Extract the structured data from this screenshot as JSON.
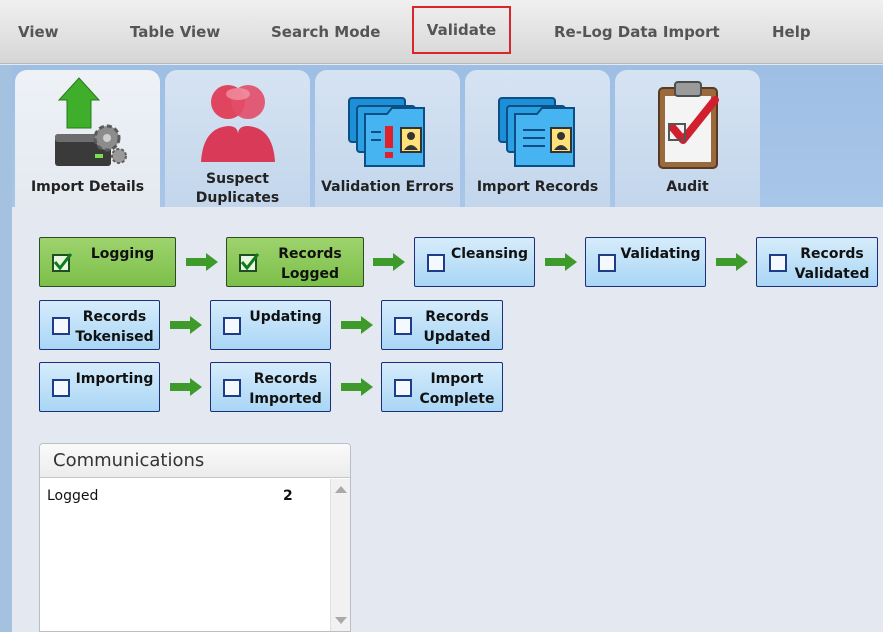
{
  "menu": {
    "view": "View",
    "table_view": "Table View",
    "search_mode": "Search Mode",
    "validate": "Validate",
    "relog": "Re-Log Data Import",
    "help": "Help"
  },
  "tabs": {
    "import_details": "Import Details",
    "suspect_1": "Suspect",
    "suspect_2": "Duplicates",
    "validation_errors": "Validation Errors",
    "import_records": "Import Records",
    "audit": "Audit"
  },
  "steps": {
    "logging": {
      "l1": "Logging",
      "l2": "",
      "done": true
    },
    "records_logged": {
      "l1": "Records",
      "l2": "Logged",
      "done": true
    },
    "cleansing": {
      "l1": "Cleansing",
      "l2": "",
      "done": false
    },
    "validating": {
      "l1": "Validating",
      "l2": "",
      "done": false
    },
    "records_validated": {
      "l1": "Records",
      "l2": "Validated",
      "done": false
    },
    "records_tokenised": {
      "l1": "Records",
      "l2": "Tokenised",
      "done": false
    },
    "updating": {
      "l1": "Updating",
      "l2": "",
      "done": false
    },
    "records_updated": {
      "l1": "Records",
      "l2": "Updated",
      "done": false
    },
    "importing": {
      "l1": "Importing",
      "l2": "",
      "done": false
    },
    "records_imported": {
      "l1": "Records",
      "l2": "Imported",
      "done": false
    },
    "import_complete": {
      "l1": "Import",
      "l2": "Complete",
      "done": false
    }
  },
  "communications": {
    "title": "Communications",
    "rows": [
      {
        "label": "Logged",
        "value": "2"
      }
    ]
  },
  "colors": {
    "highlight": "#d9262c",
    "step_done": "#8cc95a",
    "step_pending": "#bfe1f8",
    "arrow": "#3f9a2c"
  },
  "icons": {
    "import_details": "server-upload-icon",
    "suspect_duplicates": "duplicate-users-icon",
    "validation_errors": "folder-error-icon",
    "import_records": "folder-records-icon",
    "audit": "clipboard-check-icon"
  }
}
